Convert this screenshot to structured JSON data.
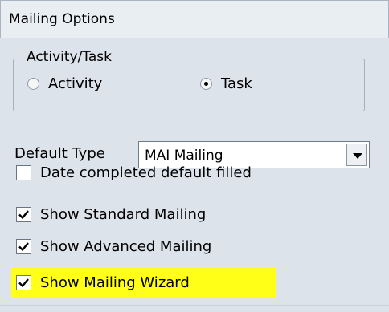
{
  "header": {
    "title": "Mailing Options"
  },
  "activity_task": {
    "legend": "Activity/Task",
    "options": [
      {
        "label": "Activity",
        "selected": false
      },
      {
        "label": "Task",
        "selected": true
      }
    ]
  },
  "default_type": {
    "label": "Default Type",
    "selected_value": "MAI  Mailing"
  },
  "checkboxes": [
    {
      "label": "Date completed default filled",
      "checked": false
    },
    {
      "label": "Show Standard Mailing",
      "checked": true
    },
    {
      "label": "Show Advanced Mailing",
      "checked": true
    },
    {
      "label": "Show Mailing Wizard",
      "checked": true,
      "highlighted": true
    }
  ],
  "colors": {
    "highlight": "#ffff18",
    "panel": "#dde3ea"
  }
}
